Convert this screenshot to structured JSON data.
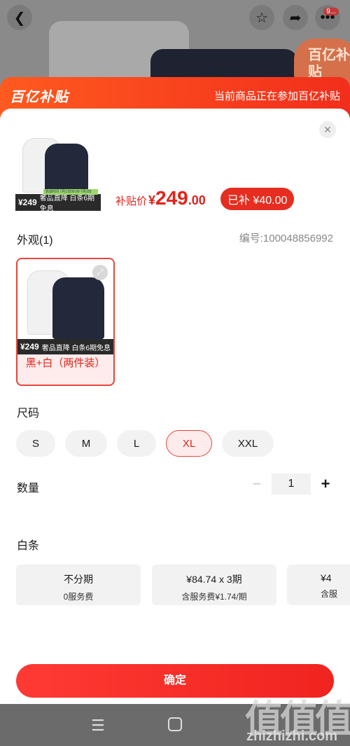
{
  "top_bar": {
    "back_icon": "chevron-left-icon",
    "favorite_icon": "star-icon",
    "share_icon": "share-icon",
    "more_icon": "more-dots-icon",
    "more_badge": "9..."
  },
  "background": {
    "badge_text": "百亿补贴"
  },
  "banner": {
    "brand": "百亿补贴",
    "text": "当前商品正在参加百亿补贴"
  },
  "product": {
    "thumb_price": "¥249",
    "thumb_tag": "奢品直降 白条6期免息",
    "thumb_promo": "活动时间 7月1日00:00-7月3日24:00",
    "price_label": "补贴价",
    "price_currency": "¥",
    "price_integer": "249",
    "price_decimal": ".00",
    "subsidy": "已补 ¥40.00"
  },
  "appearance": {
    "title": "外观(1)",
    "sku": "编号:100048856992",
    "variants": [
      {
        "label": "黑+白（两件装）",
        "thumb_price": "¥249",
        "thumb_tag": "奢品直降 白条6期免息",
        "selected": true
      }
    ]
  },
  "size": {
    "title": "尺码",
    "options": [
      "S",
      "M",
      "L",
      "XL",
      "XXL"
    ],
    "selected": "XL"
  },
  "quantity": {
    "title": "数量",
    "value": "1",
    "minus": "−",
    "plus": "+"
  },
  "baitiao": {
    "title": "白条",
    "plans": [
      {
        "line1": "不分期",
        "line2": "0服务费"
      },
      {
        "line1": "¥84.74 x 3期",
        "line2": "含服务费¥1.74/期"
      },
      {
        "line1": "¥4",
        "line2": "含服"
      }
    ]
  },
  "confirm_label": "确定",
  "watermark": {
    "logo": "值值值",
    "url": "zhizhizhi.com"
  },
  "colors": {
    "accent": "#e8453a",
    "price": "#e2231a",
    "banner": "#ff5a1f"
  }
}
